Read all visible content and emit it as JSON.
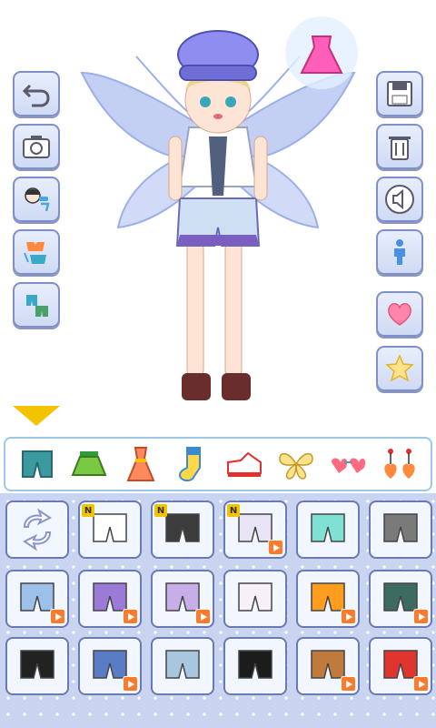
{
  "app": {
    "screen": "dress-up"
  },
  "left_toolbar": [
    {
      "name": "undo-button",
      "icon": "undo-arrow-icon"
    },
    {
      "name": "camera-button",
      "icon": "camera-icon"
    },
    {
      "name": "swap-face-button",
      "icon": "face-swap-icon"
    },
    {
      "name": "swap-top-button",
      "icon": "top-swap-icon"
    },
    {
      "name": "swap-bottom-button",
      "icon": "bottom-swap-icon"
    }
  ],
  "right_toolbar": [
    {
      "name": "save-button",
      "icon": "floppy-disk-icon"
    },
    {
      "name": "delete-button",
      "icon": "trash-icon"
    },
    {
      "name": "sound-button",
      "icon": "speaker-icon"
    },
    {
      "name": "body-button",
      "icon": "person-icon"
    },
    {
      "name": "favorite-button",
      "icon": "heart-icon"
    },
    {
      "name": "star-button",
      "icon": "star-icon"
    }
  ],
  "categories": [
    {
      "name": "pants",
      "icon": "shorts-icon",
      "selected": true
    },
    {
      "name": "skirt",
      "icon": "skirt-icon"
    },
    {
      "name": "dress",
      "icon": "dress-icon"
    },
    {
      "name": "socks",
      "icon": "sock-icon"
    },
    {
      "name": "shoes",
      "icon": "sneaker-icon"
    },
    {
      "name": "wings",
      "icon": "butterfly-wings-icon"
    },
    {
      "name": "glasses",
      "icon": "heart-glasses-icon"
    },
    {
      "name": "earrings",
      "icon": "heart-earrings-icon"
    }
  ],
  "items": [
    {
      "name": "random",
      "icon": "refresh-icon",
      "badge": "",
      "video": false
    },
    {
      "name": "white-shorts",
      "color": "#ffffff",
      "badge": "N",
      "video": false
    },
    {
      "name": "black-shorts",
      "color": "#3c3c3c",
      "badge": "N",
      "video": false
    },
    {
      "name": "lavender-plaid-shorts",
      "color": "#e8e4f6",
      "badge": "N",
      "video": true
    },
    {
      "name": "mint-chevron-shorts",
      "color": "#7fe0d4",
      "badge": "",
      "video": false
    },
    {
      "name": "argyle-pants",
      "color": "#7a7a7a",
      "badge": "",
      "video": false
    },
    {
      "name": "pink-jeans",
      "color": "#9dc0e8",
      "badge": "",
      "video": true
    },
    {
      "name": "purple-striped-shorts",
      "color": "#9c7ad8",
      "badge": "",
      "video": true
    },
    {
      "name": "lilac-snowflake-shorts",
      "color": "#c8aee8",
      "badge": "",
      "video": true
    },
    {
      "name": "white-pants",
      "color": "#f7f0f8",
      "badge": "",
      "video": false
    },
    {
      "name": "orange-briefs",
      "color": "#ff9e1e",
      "badge": "",
      "video": true
    },
    {
      "name": "teal-shorts",
      "color": "#3d6b62",
      "badge": "",
      "video": true
    },
    {
      "name": "black-bloomers",
      "color": "#222222",
      "badge": "",
      "video": false
    },
    {
      "name": "denim-shorts",
      "color": "#5a7cc6",
      "badge": "",
      "video": true
    },
    {
      "name": "light-jeans",
      "color": "#a9c6e0",
      "badge": "",
      "video": false
    },
    {
      "name": "black-pants",
      "color": "#1c1c1c",
      "badge": "",
      "video": false
    },
    {
      "name": "tan-shorts",
      "color": "#c07a3e",
      "badge": "",
      "video": true
    },
    {
      "name": "red-shorts",
      "color": "#e0342e",
      "badge": "",
      "video": true
    }
  ],
  "colors": {
    "button_bg": "#cfdaf4",
    "grid_bg": "#c8d4f0",
    "accent_yellow": "#f2c400",
    "video_badge": "#ff7a2a"
  }
}
